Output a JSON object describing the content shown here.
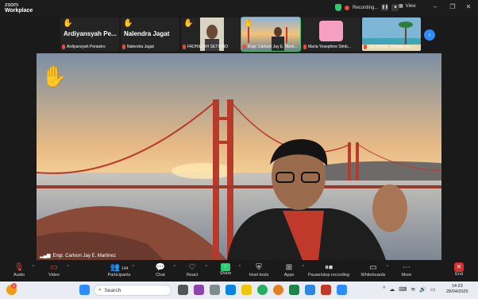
{
  "app": {
    "brand_line1": "zoom",
    "brand_line2": "Workplace"
  },
  "titlebar": {
    "recording_label": "Recording...",
    "view_label": "View"
  },
  "thumbnails": [
    {
      "big_name": "Ardiyansyah Pe...",
      "label": "Ardiyansyah Perawiro",
      "hand": true
    },
    {
      "big_name": "Nalendra Jagat",
      "label": "Nalendra Jagat",
      "hand": true
    },
    {
      "big_name": "",
      "label": "FADHILLAH SETIONO",
      "hand": true
    },
    {
      "big_name": "",
      "label": "Engr. Carlson Jay E. Marti...",
      "hand": true,
      "active": true
    },
    {
      "big_name": "",
      "label": "Maria Yosephine Simb...",
      "hand": false
    },
    {
      "big_name": "",
      "label": "121380055_Diwage Se...",
      "hand": false
    }
  ],
  "main_video": {
    "speaker_label": "Engr. Carlson Jay E. Martinez"
  },
  "toolbar": {
    "audio": "Audio",
    "video": "Video",
    "participants": "Participants",
    "participants_count": "144",
    "chat": "Chat",
    "react": "React",
    "share": "Share",
    "host_tools": "Host tools",
    "apps": "Apps",
    "pause_recording": "Pause/stop recording",
    "whiteboards": "Whiteboards",
    "more": "More",
    "end": "End"
  },
  "taskbar": {
    "search_placeholder": "Search",
    "notification_count": "2",
    "time": "14:23",
    "date": "28/04/2025"
  },
  "colors": {
    "accent_green": "#2ecc71",
    "record_red": "#e74c3c",
    "nav_blue": "#2d8cff",
    "end_red": "#d63031"
  }
}
